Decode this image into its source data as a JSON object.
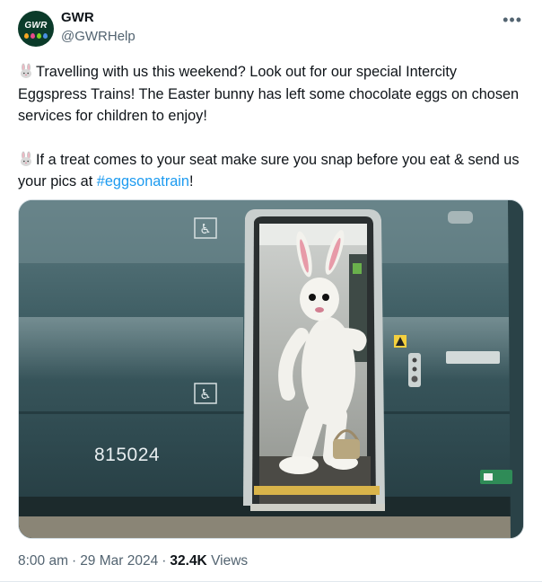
{
  "author": {
    "name": "GWR",
    "handle": "@GWRHelp",
    "avatar_text": "GWR"
  },
  "more_icon": "more-horizontal-icon",
  "tweet": {
    "paragraph1": "Travelling with us this weekend? Look out for our special Intercity Eggspress Trains! The Easter bunny has left some chocolate eggs on chosen services for children to enjoy!",
    "paragraph2_before": "If a treat comes to your seat make sure you snap before you eat & send us your pics at ",
    "hashtag": "#eggsonatrain",
    "paragraph2_after": "!",
    "emoji": "rabbit-face-icon"
  },
  "media": {
    "train_number": "815024",
    "description_icons": [
      "wheelchair-icon",
      "wheelchair-icon"
    ]
  },
  "meta": {
    "time": "8:00 am",
    "date": "29 Mar 2024",
    "views_count": "32.4K",
    "views_label": "Views"
  },
  "colors": {
    "link": "#1d9bf0",
    "secondary_text": "#536471",
    "avatar_bg": "#0b3b2a"
  }
}
